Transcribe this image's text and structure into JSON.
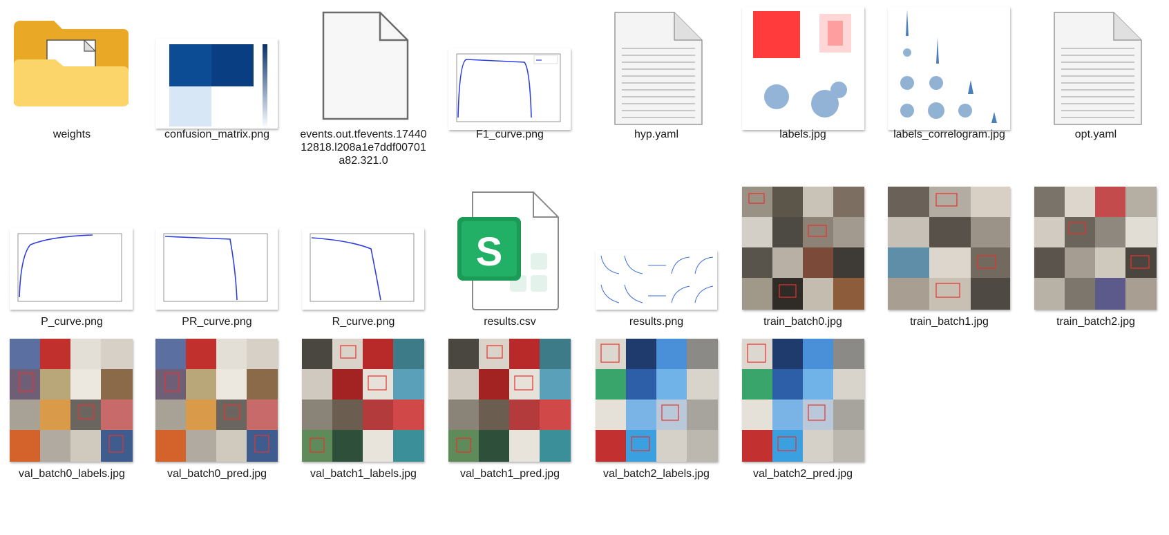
{
  "files": [
    {
      "name": "weights",
      "type": "folder"
    },
    {
      "name": "confusion_matrix.png",
      "type": "image"
    },
    {
      "name": "events.out.tfevents.1744012818.l208a1e7ddf00701a82.321.0",
      "type": "file"
    },
    {
      "name": "F1_curve.png",
      "type": "image"
    },
    {
      "name": "hyp.yaml",
      "type": "text"
    },
    {
      "name": "labels.jpg",
      "type": "image"
    },
    {
      "name": "labels_correlogram.jpg",
      "type": "image"
    },
    {
      "name": "opt.yaml",
      "type": "text"
    },
    {
      "name": "P_curve.png",
      "type": "image"
    },
    {
      "name": "PR_curve.png",
      "type": "image"
    },
    {
      "name": "R_curve.png",
      "type": "image"
    },
    {
      "name": "results.csv",
      "type": "spreadsheet"
    },
    {
      "name": "results.png",
      "type": "image"
    },
    {
      "name": "train_batch0.jpg",
      "type": "image"
    },
    {
      "name": "train_batch1.jpg",
      "type": "image"
    },
    {
      "name": "train_batch2.jpg",
      "type": "image"
    },
    {
      "name": "val_batch0_labels.jpg",
      "type": "image"
    },
    {
      "name": "val_batch0_pred.jpg",
      "type": "image"
    },
    {
      "name": "val_batch1_labels.jpg",
      "type": "image"
    },
    {
      "name": "val_batch1_pred.jpg",
      "type": "image"
    },
    {
      "name": "val_batch2_labels.jpg",
      "type": "image"
    },
    {
      "name": "val_batch2_pred.jpg",
      "type": "image"
    }
  ],
  "icons": {
    "folder": "folder-icon",
    "file": "blank-file-icon",
    "text": "text-file-icon",
    "spreadsheet": "spreadsheet-s-icon"
  },
  "colors": {
    "folder": "#f5c342",
    "chart_line": "#2f3fdf",
    "matrix_dark": "#0c4c94",
    "spreadsheet_green": "#1a9b56",
    "bbox_red": "#e8312f"
  }
}
